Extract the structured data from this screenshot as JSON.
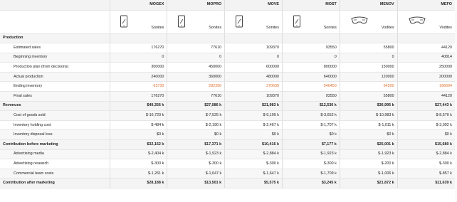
{
  "products": [
    {
      "name": "MOGEX",
      "segment": "Sonites",
      "icon": "phone-icon"
    },
    {
      "name": "MOPRO",
      "segment": "Sonites",
      "icon": "phone-icon"
    },
    {
      "name": "MOVE",
      "segment": "Sonites",
      "icon": "phone-icon"
    },
    {
      "name": "MOST",
      "segment": "Sonites",
      "icon": "phone-icon"
    },
    {
      "name": "MENOV",
      "segment": "Vodites",
      "icon": "goggles-icon"
    },
    {
      "name": "MEFO",
      "segment": "Vodites",
      "icon": "goggles-icon"
    }
  ],
  "rows": [
    {
      "type": "section",
      "label": "Production",
      "values": [
        "",
        "",
        "",
        "",
        "",
        ""
      ]
    },
    {
      "type": "row",
      "label": "Estimated sales",
      "values": [
        "176270",
        "77610",
        "109370",
        "93550",
        "55800",
        "44120"
      ]
    },
    {
      "type": "row",
      "label": "Beginning inventory",
      "values": [
        "0",
        "0",
        "0",
        "0",
        "0",
        "40814"
      ]
    },
    {
      "type": "row",
      "label": "Production plan (from decisions)",
      "values": [
        "300000",
        "450000",
        "600000",
        "800000",
        "150000",
        "250000"
      ]
    },
    {
      "type": "row",
      "label": "Actual production",
      "values": [
        "240000",
        "360000",
        "480000",
        "640000",
        "120000",
        "200000"
      ]
    },
    {
      "type": "row",
      "label": "Ending inventory",
      "values": [
        "63730",
        "282390",
        "370630",
        "546450",
        "64200",
        "196694"
      ],
      "highlight": true
    },
    {
      "type": "row",
      "label": "Final sales",
      "values": [
        "176270",
        "77610",
        "109370",
        "93550",
        "55800",
        "44120"
      ]
    },
    {
      "type": "section",
      "label": "Revenues",
      "values": [
        "$49,356 k",
        "$27,086 k",
        "$21,983 k",
        "$12,536 k",
        "$36,995 k",
        "$27,443 k"
      ]
    },
    {
      "type": "row",
      "label": "Cost of goods sold",
      "values": [
        "$-16,720 k",
        "$-7,525 k",
        "$-9,100 k",
        "$-3,652 k",
        "$-10,983 k",
        "$-8,670 k"
      ]
    },
    {
      "type": "row",
      "label": "Inventory holding cost",
      "values": [
        "$-484 k",
        "$-2,190 k",
        "$-2,467 k",
        "$-1,707 k",
        "$-1,011 k",
        "$-3,092 k"
      ]
    },
    {
      "type": "row",
      "label": "Inventory disposal loss",
      "values": [
        "$0 k",
        "$0 k",
        "$0 k",
        "$0 k",
        "$0 k",
        "$0 k"
      ]
    },
    {
      "type": "section",
      "label": "Contribution before marketing",
      "values": [
        "$32,152 k",
        "$17,371 k",
        "$10,416 k",
        "$7,177 k",
        "$25,001 k",
        "$15,680 k"
      ]
    },
    {
      "type": "row",
      "label": "Advertising media",
      "values": [
        "$-2,404 k",
        "$-1,923 k",
        "$-2,884 k",
        "$-1,923 k",
        "$-1,923 k",
        "$-2,884 k"
      ]
    },
    {
      "type": "row",
      "label": "Advertising research",
      "values": [
        "$-300 k",
        "$-300 k",
        "$-300 k",
        "$-300 k",
        "$-200 k",
        "$-300 k"
      ]
    },
    {
      "type": "row",
      "label": "Commercial team costs",
      "values": [
        "$-1,261 k",
        "$-1,647 k",
        "$-1,647 k",
        "$-1,709 k",
        "$-1,006 k",
        "$-857 k"
      ]
    },
    {
      "type": "section",
      "label": "Contribution after marketing",
      "values": [
        "$28,188 k",
        "$13,501 k",
        "$5,575 k",
        "$3,245 k",
        "$21,872 k",
        "$11,639 k"
      ]
    }
  ],
  "colors": {
    "highlight": "#e0702e",
    "section_bg": "#f4f4f4",
    "header_bg": "#f3f3f3"
  }
}
